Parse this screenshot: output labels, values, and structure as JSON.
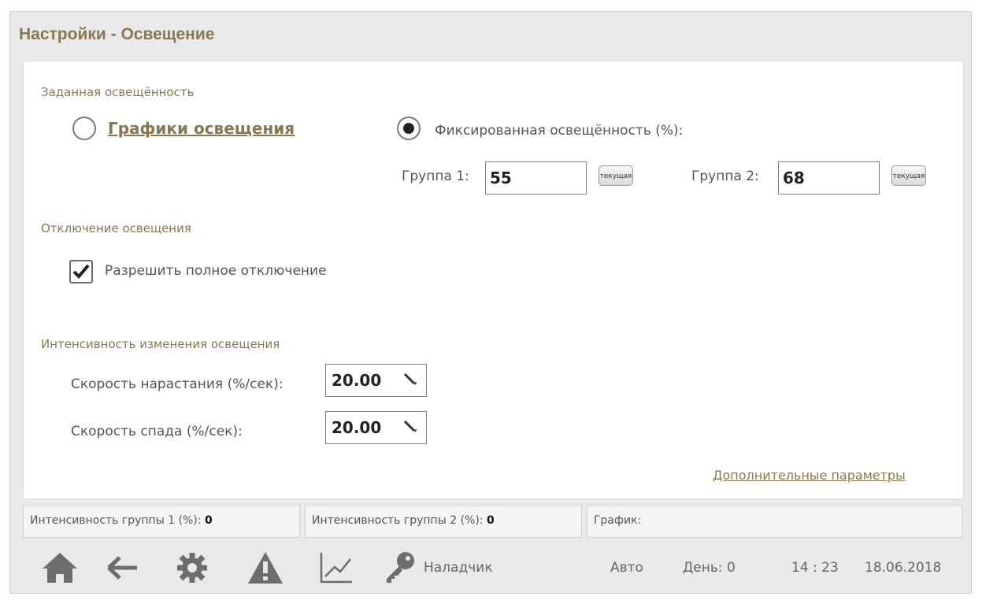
{
  "title": "Настройки - Освещение",
  "setpoint": {
    "section": "Заданная освещённость",
    "schedule_link": "Графики освещения",
    "fixed_label": "Фиксированная освещённость (%):",
    "mode": "fixed",
    "group1_label": "Группа 1:",
    "group1_value": "55",
    "group2_label": "Группа 2:",
    "group2_value": "68",
    "current_button": "текущая"
  },
  "shutdown": {
    "section": "Отключение освещения",
    "allow_label": "Разрешить полное отключение",
    "allow_checked": true
  },
  "intensity": {
    "section": "Интенсивность изменения освещения",
    "rise_label": "Скорость нарастания (%/сек):",
    "rise_value": "20.00",
    "fall_label": "Скорость спада (%/сек):",
    "fall_value": "20.00"
  },
  "more_link": "Дополнительные параметры",
  "status": {
    "group1_label": "Интенсивность группы 1 (%):",
    "group1_value": "0",
    "group2_label": "Интенсивность группы 2 (%):",
    "group2_value": "0",
    "schedule_label": "График:"
  },
  "bottom": {
    "user": "Наладчик",
    "mode": "Авто",
    "day": "День: 0",
    "time": "14 : 23",
    "date": "18.06.2018",
    "icon_color": "#6d6d6d"
  }
}
